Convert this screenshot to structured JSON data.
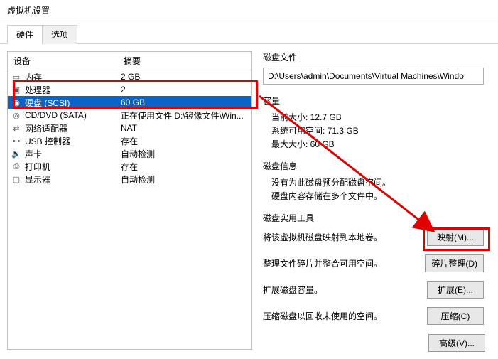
{
  "window": {
    "title": "虚拟机设置"
  },
  "tabs": {
    "hardware": "硬件",
    "options": "选项"
  },
  "list": {
    "header_device": "设备",
    "header_summary": "摘要",
    "rows": [
      {
        "icon": "memory",
        "name": "内存",
        "summary": "2 GB"
      },
      {
        "icon": "cpu",
        "name": "处理器",
        "summary": "2"
      },
      {
        "icon": "disk",
        "name": "硬盘 (SCSI)",
        "summary": "60 GB"
      },
      {
        "icon": "cd",
        "name": "CD/DVD (SATA)",
        "summary": "正在使用文件 D:\\镜像文件\\Win..."
      },
      {
        "icon": "net",
        "name": "网络适配器",
        "summary": "NAT"
      },
      {
        "icon": "usb",
        "name": "USB 控制器",
        "summary": "存在"
      },
      {
        "icon": "sound",
        "name": "声卡",
        "summary": "自动检测"
      },
      {
        "icon": "printer",
        "name": "打印机",
        "summary": "存在"
      },
      {
        "icon": "display",
        "name": "显示器",
        "summary": "自动检测"
      }
    ]
  },
  "disk_file": {
    "title": "磁盘文件",
    "path": "D:\\Users\\admin\\Documents\\Virtual Machines\\Windo"
  },
  "capacity": {
    "title": "容量",
    "current": "当前大小: 12.7 GB",
    "free": "系统可用空间: 71.3 GB",
    "max": "最大大小: 60 GB"
  },
  "disk_info": {
    "title": "磁盘信息",
    "line1": "没有为此磁盘预分配磁盘空间。",
    "line2": "硬盘内容存储在多个文件中。"
  },
  "tools": {
    "title": "磁盘实用工具",
    "map_desc": "将该虚拟机磁盘映射到本地卷。",
    "map_btn": "映射(M)...",
    "defrag_desc": "整理文件碎片并整合可用空间。",
    "defrag_btn": "碎片整理(D)",
    "expand_desc": "扩展磁盘容量。",
    "expand_btn": "扩展(E)...",
    "compact_desc": "压缩磁盘以回收未使用的空间。",
    "compact_btn": "压缩(C)"
  },
  "advanced_btn": "高级(V)..."
}
